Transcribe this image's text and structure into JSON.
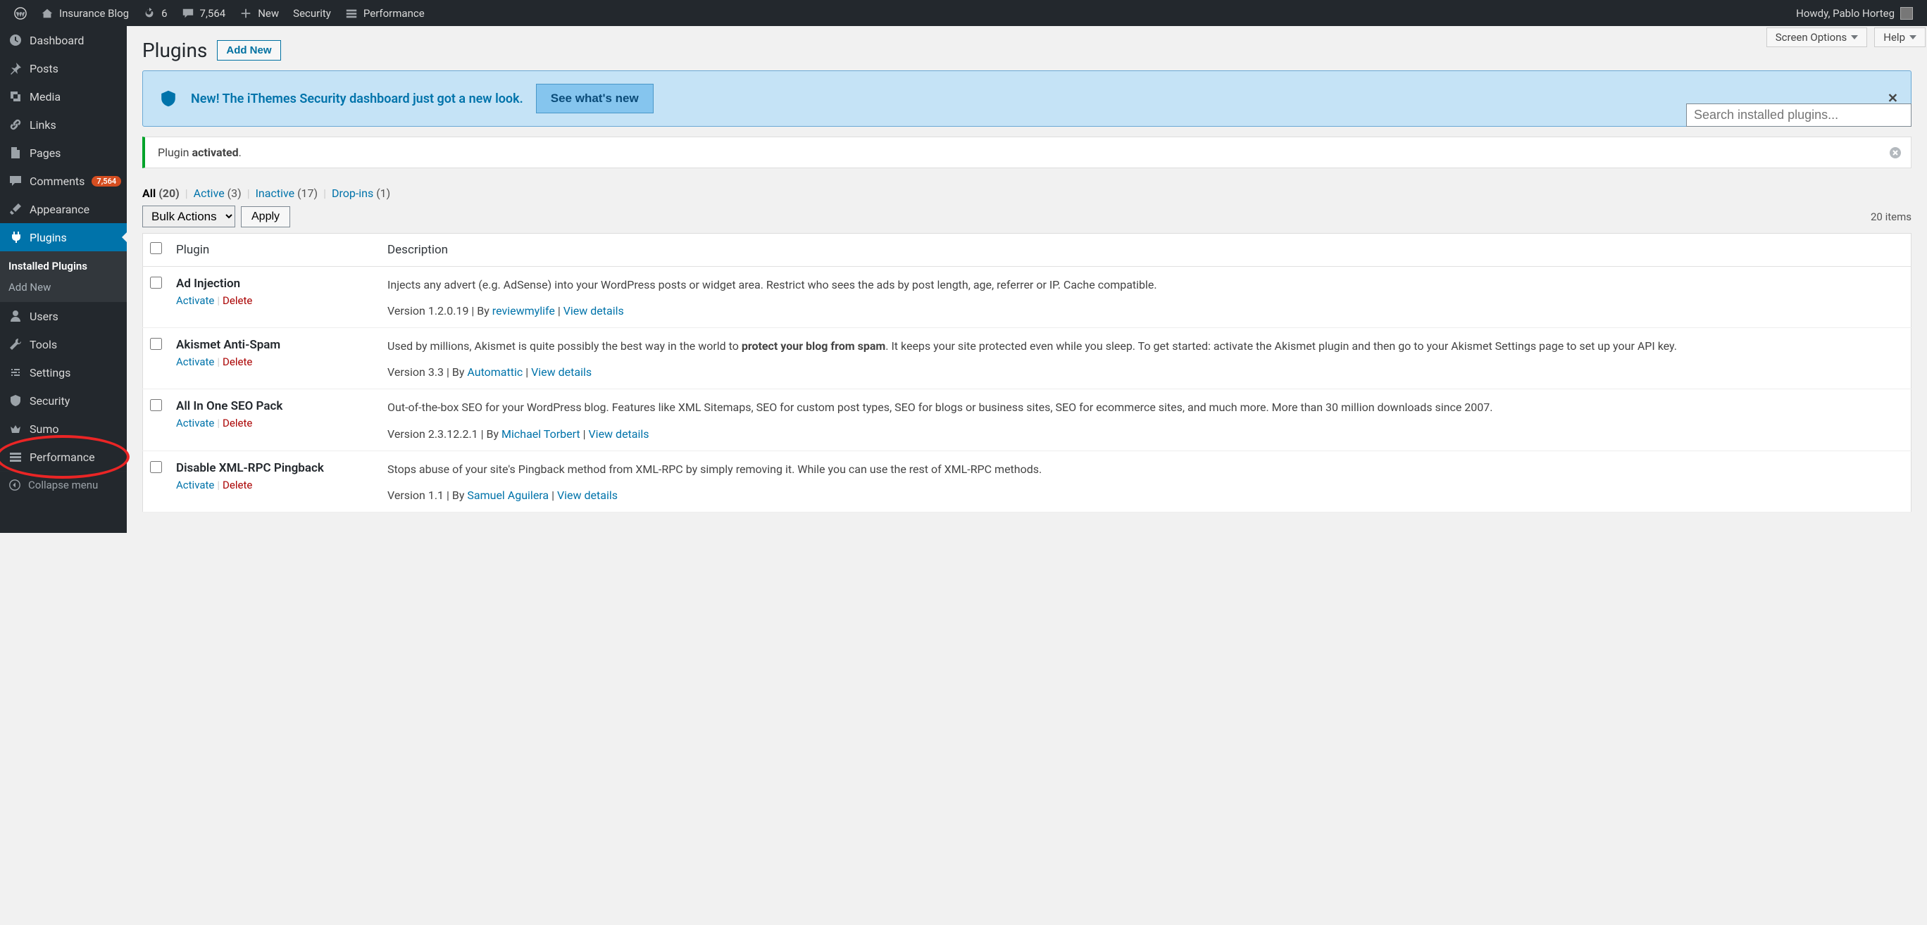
{
  "adminbar": {
    "site_name": "Insurance Blog",
    "updates_count": "6",
    "comments_count": "7,564",
    "new_label": "New",
    "security_label": "Security",
    "performance_label": "Performance",
    "howdy": "Howdy, Pablo Horteg"
  },
  "sidebar": {
    "items": [
      {
        "label": "Dashboard",
        "icon": "dashboard"
      },
      {
        "label": "Posts",
        "icon": "pin"
      },
      {
        "label": "Media",
        "icon": "media"
      },
      {
        "label": "Links",
        "icon": "link"
      },
      {
        "label": "Pages",
        "icon": "page"
      },
      {
        "label": "Comments",
        "icon": "comment",
        "badge": "7,564"
      },
      {
        "label": "Appearance",
        "icon": "brush"
      },
      {
        "label": "Plugins",
        "icon": "plug",
        "current": true
      },
      {
        "label": "Users",
        "icon": "user"
      },
      {
        "label": "Tools",
        "icon": "wrench"
      },
      {
        "label": "Settings",
        "icon": "settings"
      },
      {
        "label": "Security",
        "icon": "shield"
      },
      {
        "label": "Sumo",
        "icon": "crown"
      },
      {
        "label": "Performance",
        "icon": "perf"
      }
    ],
    "submenu": {
      "installed": "Installed Plugins",
      "addnew": "Add New"
    },
    "collapse": "Collapse menu"
  },
  "screen_options": "Screen Options",
  "help": "Help",
  "page_title": "Plugins",
  "add_new": "Add New",
  "ithemes_notice": {
    "text": "New! The iThemes Security dashboard just got a new look.",
    "cta": "See what's new"
  },
  "activated_notice": {
    "pre": "Plugin ",
    "strong": "activated",
    "post": "."
  },
  "filters": {
    "all": {
      "label": "All",
      "count": "(20)"
    },
    "active": {
      "label": "Active",
      "count": "(3)"
    },
    "inactive": {
      "label": "Inactive",
      "count": "(17)"
    },
    "dropins": {
      "label": "Drop-ins",
      "count": "(1)"
    }
  },
  "bulk_placeholder": "Bulk Actions",
  "apply": "Apply",
  "items_count": "20 items",
  "search_placeholder": "Search installed plugins...",
  "cols": {
    "plugin": "Plugin",
    "desc": "Description"
  },
  "row_actions": {
    "activate": "Activate",
    "delete": "Delete"
  },
  "plugins": [
    {
      "name": "Ad Injection",
      "desc": "Injects any advert (e.g. AdSense) into your WordPress posts or widget area. Restrict who sees the ads by post length, age, referrer or IP. Cache compatible.",
      "version": "Version 1.2.0.19",
      "by": "By ",
      "author": "reviewmylife",
      "details": "View details"
    },
    {
      "name": "Akismet Anti-Spam",
      "desc_pre": "Used by millions, Akismet is quite possibly the best way in the world to ",
      "desc_strong": "protect your blog from spam",
      "desc_post": ". It keeps your site protected even while you sleep. To get started: activate the Akismet plugin and then go to your Akismet Settings page to set up your API key.",
      "version": "Version 3.3",
      "by": "By ",
      "author": "Automattic",
      "details": "View details"
    },
    {
      "name": "All In One SEO Pack",
      "desc": "Out-of-the-box SEO for your WordPress blog. Features like XML Sitemaps, SEO for custom post types, SEO for blogs or business sites, SEO for ecommerce sites, and much more. More than 30 million downloads since 2007.",
      "version": "Version 2.3.12.2.1",
      "by": "By ",
      "author": "Michael Torbert",
      "details": "View details"
    },
    {
      "name": "Disable XML-RPC Pingback",
      "desc": "Stops abuse of your site's Pingback method from XML-RPC by simply removing it. While you can use the rest of XML-RPC methods.",
      "version": "Version 1.1",
      "by": "By ",
      "author": "Samuel Aguilera",
      "details": "View details"
    }
  ]
}
